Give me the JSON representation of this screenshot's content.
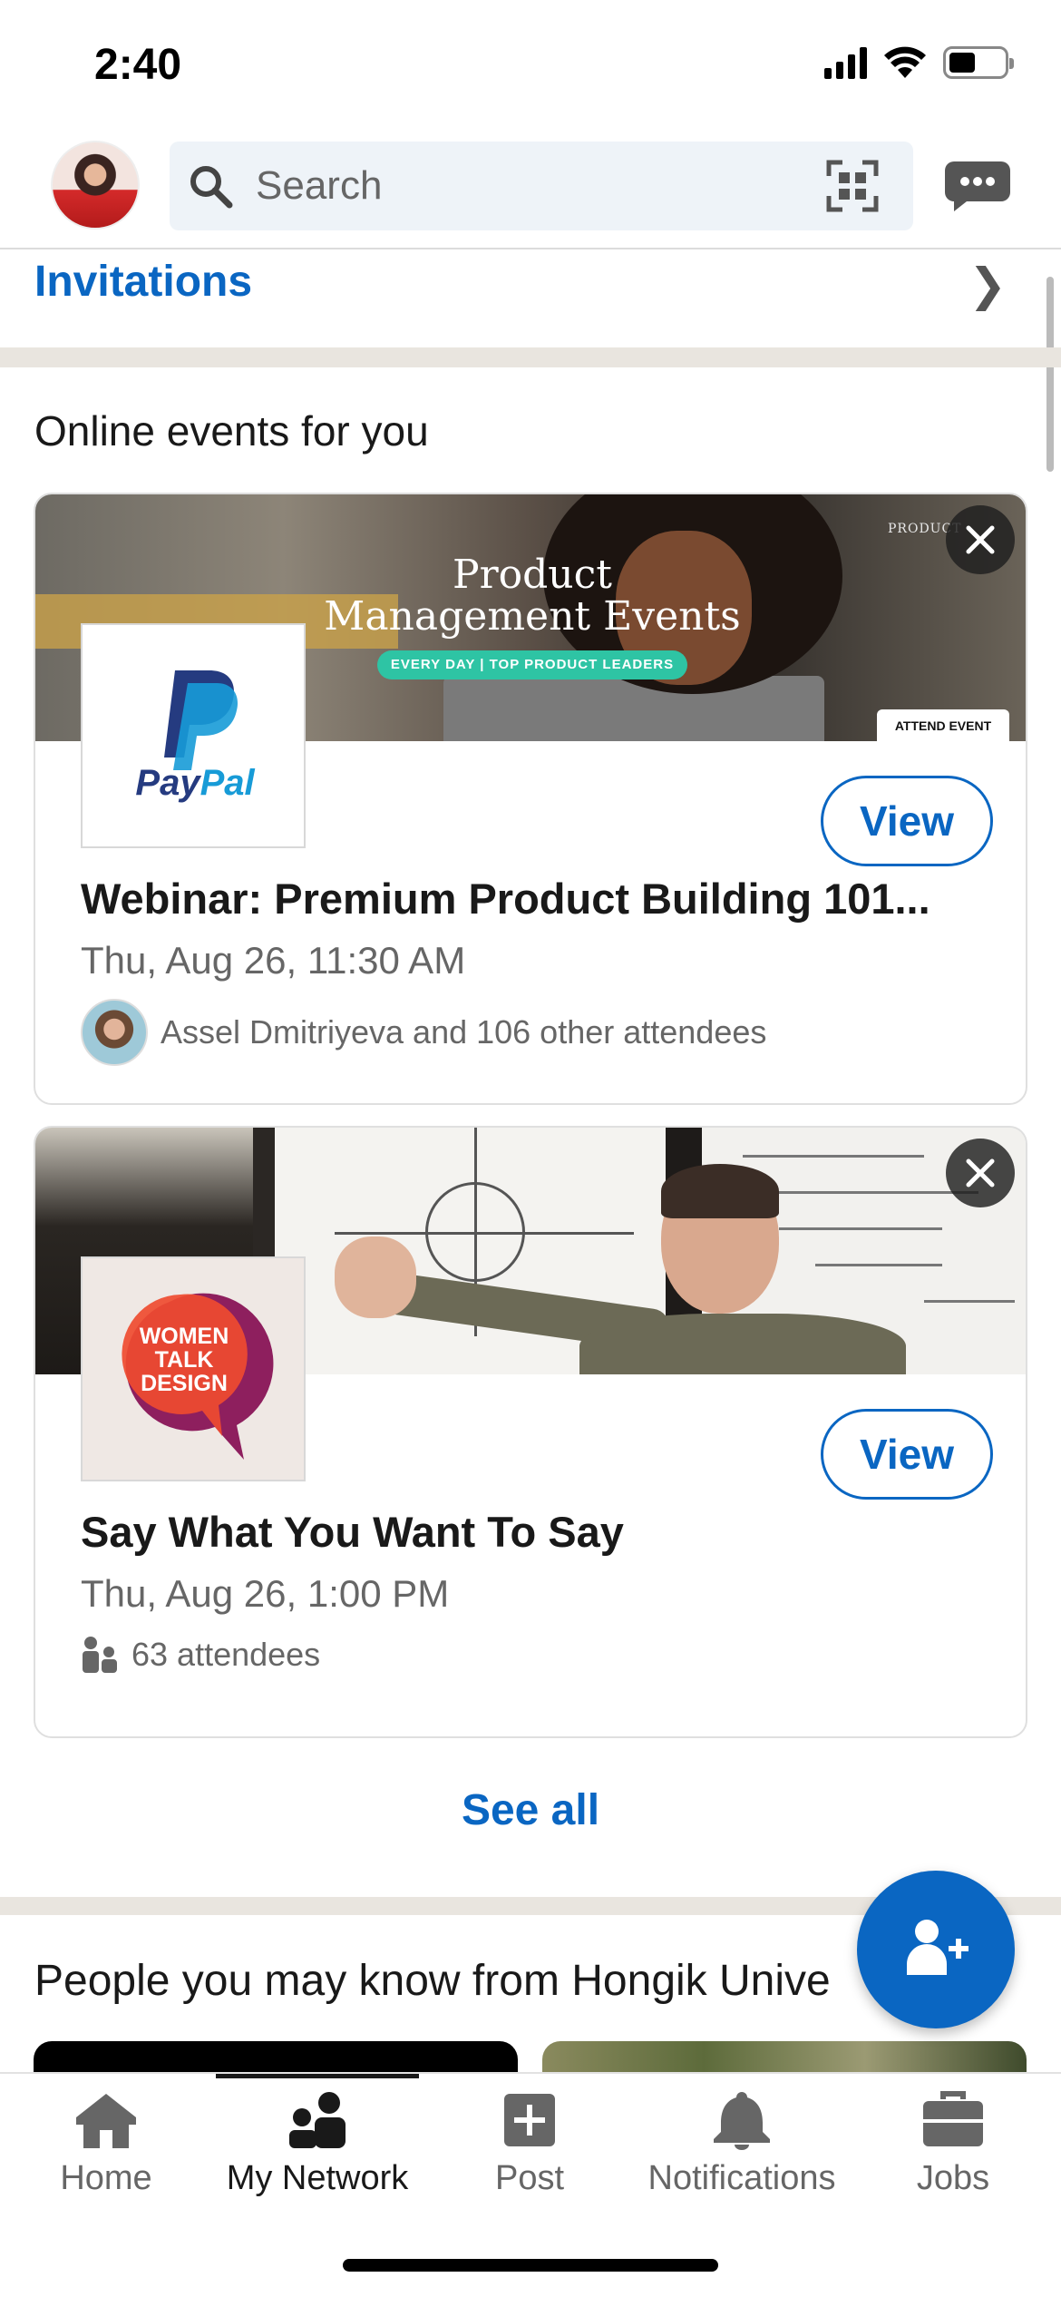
{
  "status_bar": {
    "time": "2:40"
  },
  "header": {
    "search_placeholder": "Search"
  },
  "invitations": {
    "title": "Invitations"
  },
  "online_events": {
    "title": "Online events for you",
    "events": [
      {
        "banner_title_line1": "Product",
        "banner_title_line2": "Management Events",
        "banner_pill": "EVERY DAY | TOP PRODUCT LEADERS",
        "banner_brand": "PRODUCT",
        "banner_badge": "ATTEND EVENT",
        "logo_text_a": "Pay",
        "logo_text_b": "Pal",
        "view_label": "View",
        "title": "Webinar: Premium Product Building 101...",
        "date": "Thu, Aug 26, 11:30 AM",
        "attendees": "Assel Dmitriyeva and 106 other attendees"
      },
      {
        "logo_line1": "WOMEN",
        "logo_line2": "TALK",
        "logo_line3": "DESIGN",
        "view_label": "View",
        "title": "Say What You Want To Say",
        "date": "Thu, Aug 26, 1:00 PM",
        "attendees": "63 attendees"
      }
    ],
    "see_all": "See all"
  },
  "people_you_may_know": {
    "title": "People you may know from Hongik Unive"
  },
  "bottom_nav": {
    "items": [
      {
        "label": "Home",
        "icon": "home-icon"
      },
      {
        "label": "My Network",
        "icon": "my-network-icon",
        "active": true
      },
      {
        "label": "Post",
        "icon": "post-icon"
      },
      {
        "label": "Notifications",
        "icon": "bell-icon"
      },
      {
        "label": "Jobs",
        "icon": "briefcase-icon"
      }
    ]
  },
  "colors": {
    "accent": "#0a66c2",
    "divider": "#e9e5df",
    "pill": "#2ec4a4"
  }
}
